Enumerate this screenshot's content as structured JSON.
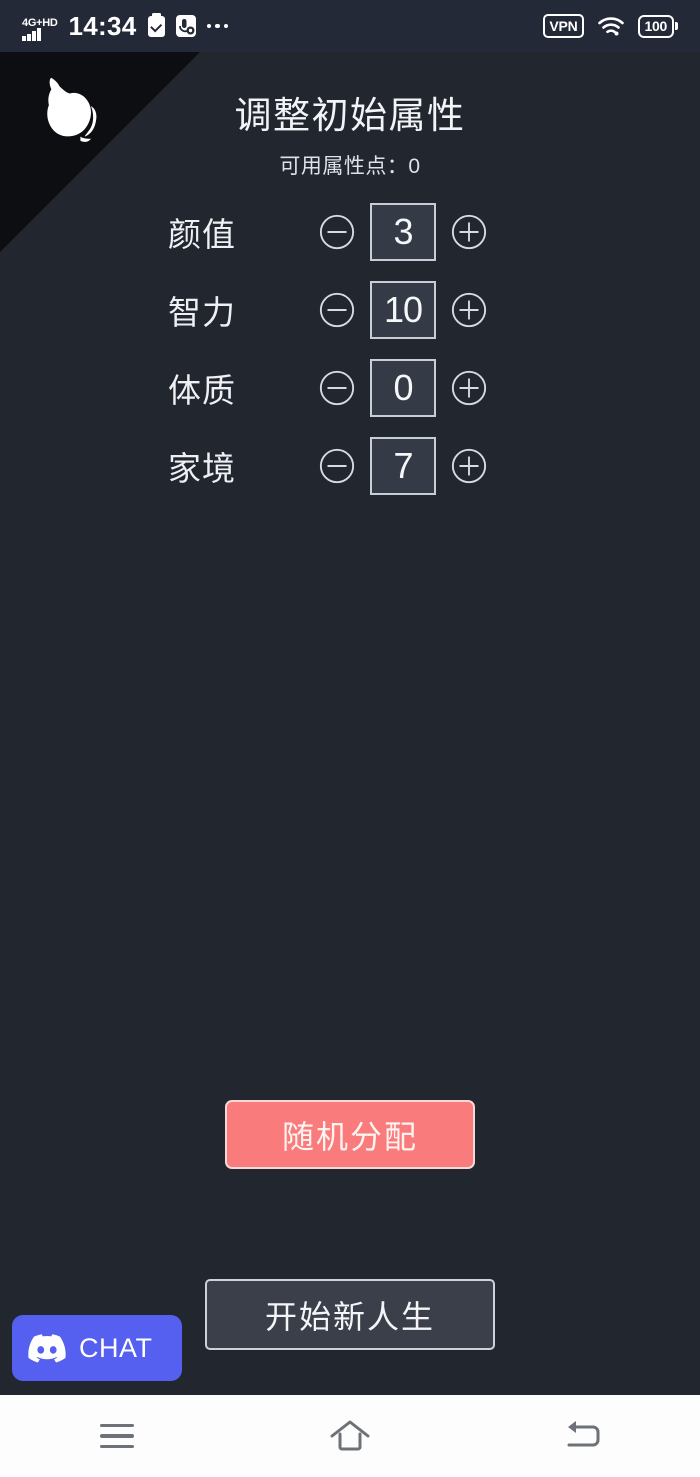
{
  "status_bar": {
    "network_type": "4G+HD",
    "time": "14:34",
    "clipboard_icon": "clipboard-check-icon",
    "mic_icon": "mic-muted-icon",
    "overflow_icon": "more-dots-icon",
    "vpn_label": "VPN",
    "wifi_icon": "wifi-icon",
    "battery_level": "100"
  },
  "corner": {
    "logo_icon": "cat-logo-icon"
  },
  "header": {
    "title": "调整初始属性",
    "subtitle": "可用属性点：0",
    "available_points": 0
  },
  "attributes": [
    {
      "label": "颜值",
      "value": "3",
      "decrement_icon": "circle-minus-icon",
      "increment_icon": "circle-plus-icon"
    },
    {
      "label": "智力",
      "value": "10",
      "decrement_icon": "circle-minus-icon",
      "increment_icon": "circle-plus-icon"
    },
    {
      "label": "体质",
      "value": "0",
      "decrement_icon": "circle-minus-icon",
      "increment_icon": "circle-plus-icon"
    },
    {
      "label": "家境",
      "value": "7",
      "decrement_icon": "circle-minus-icon",
      "increment_icon": "circle-plus-icon"
    }
  ],
  "actions": {
    "random_label": "随机分配",
    "start_label": "开始新人生"
  },
  "discord": {
    "label": "CHAT",
    "logo_icon": "discord-logo-icon"
  },
  "nav_bar": {
    "recents_icon": "hamburger-menu-icon",
    "home_icon": "home-icon",
    "back_icon": "back-arrow-icon"
  },
  "colors": {
    "background": "#21262f",
    "status_bar": "#232936",
    "accent_red": "#f97b7b",
    "value_box": "#343b46",
    "border_light": "#c9cdd5",
    "discord_blurple": "#5560f1",
    "nav_bar": "#fdfdfd"
  }
}
